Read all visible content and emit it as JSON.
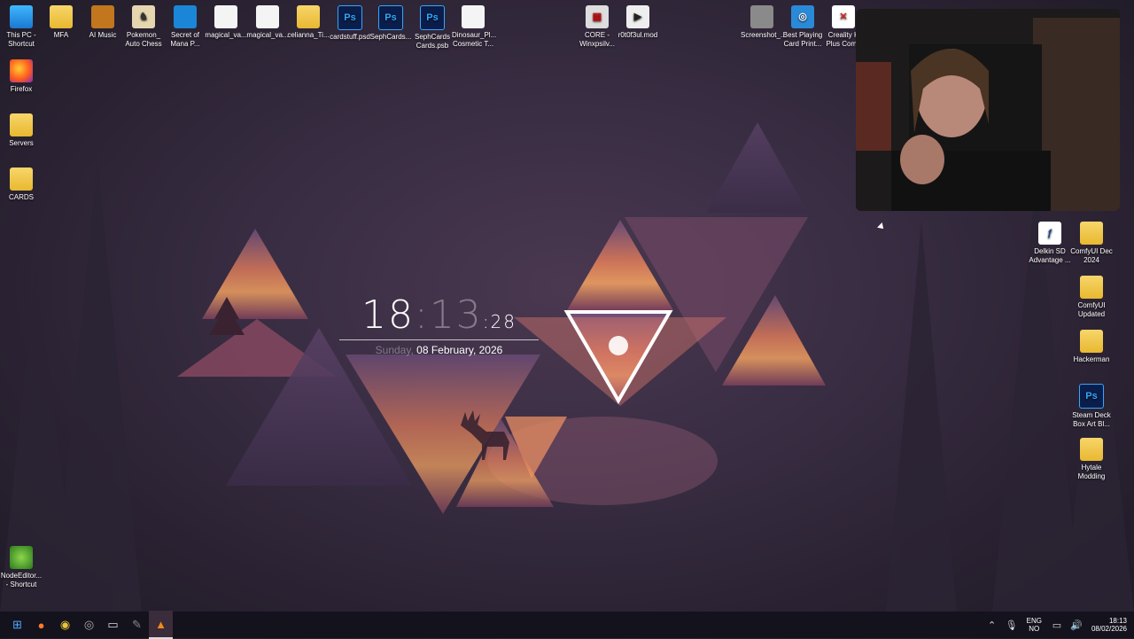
{
  "desktop_icons_top": [
    {
      "label": "This PC - Shortcut",
      "icon": "this-pc-icon"
    },
    {
      "label": "MFA",
      "icon": "folder-icon"
    },
    {
      "label": "AI Music",
      "icon": "folder-icon"
    },
    {
      "label": "Pokemon_ Auto Chess",
      "icon": "pokemon-icon"
    },
    {
      "label": "Secret of Mana P...",
      "icon": "app-icon"
    },
    {
      "label": "magical_va...",
      "icon": "document-icon"
    },
    {
      "label": "magical_va...",
      "icon": "document-icon"
    },
    {
      "label": "celianna_Ti...",
      "icon": "folder-icon"
    },
    {
      "label": "cardstuff.psd",
      "icon": "photoshop-icon"
    },
    {
      "label": "SephCards...",
      "icon": "photoshop-icon"
    },
    {
      "label": "SephCards Cards.psb",
      "icon": "photoshop-icon"
    },
    {
      "label": "Dinosaur_Pl... Cosmetic T...",
      "icon": "document-icon"
    },
    {
      "label": "CORE - Winxpsilv...",
      "icon": "core-icon"
    },
    {
      "label": "r0t0f3ul.mod",
      "icon": "mod-icon"
    },
    {
      "label": "Screenshot_...",
      "icon": "screenshot-icon"
    },
    {
      "label": "Best Playing Card Print...",
      "icon": "nexo-icon"
    },
    {
      "label": "Creality K Plus Comb",
      "icon": "creality-icon"
    }
  ],
  "desktop_icons_left": [
    {
      "label": "Firefox",
      "icon": "firefox-icon"
    },
    {
      "label": "Servers",
      "icon": "folder-icon"
    },
    {
      "label": "CARDS",
      "icon": "folder-icon"
    },
    {
      "label": "NodeEditor... - Shortcut",
      "icon": "node-editor-icon"
    }
  ],
  "desktop_icons_right": [
    {
      "label": "Delkin SD Advantage ...",
      "icon": "delkin-icon"
    },
    {
      "label": "ComfyUI Dec 2024",
      "icon": "folder-icon"
    },
    {
      "label": "ComfyUI Updated",
      "icon": "folder-icon"
    },
    {
      "label": "Hackerman",
      "icon": "folder-icon"
    },
    {
      "label": "Steam Deck Box Art Bl...",
      "icon": "photoshop-icon"
    },
    {
      "label": "Hytale Modding",
      "icon": "folder-icon"
    }
  ],
  "clock": {
    "hours": "18",
    "sep": ":",
    "minutes": "13",
    "seconds": ":28",
    "day": "Sunday,",
    "date": "08 February, 2026"
  },
  "taskbar": {
    "apps": [
      "start-icon",
      "firefox-icon",
      "chrome-icon",
      "chrome-alt-icon",
      "terminal-icon",
      "pen-icon",
      "vlc-icon"
    ],
    "lang_top": "ENG",
    "lang_bottom": "NO",
    "time": "18:13",
    "date": "08/02/2026"
  },
  "colors": {
    "accent": "#f0a060",
    "taskbar": "#14121c",
    "folder": "#f0c84a"
  }
}
